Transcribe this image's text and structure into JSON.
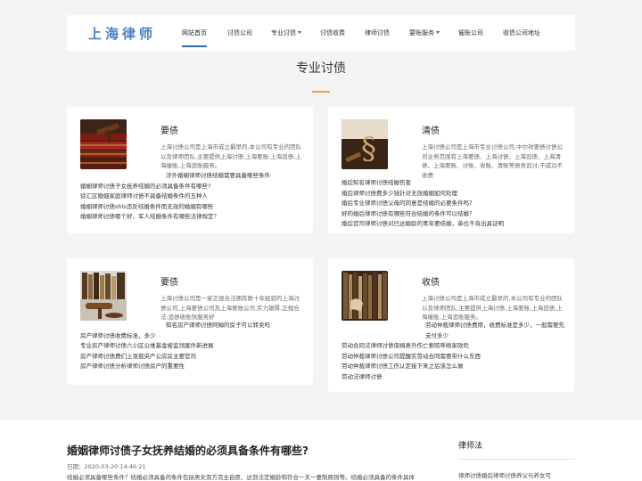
{
  "header": {
    "logo": "上海律师",
    "nav": [
      {
        "label": "网站首页",
        "active": true,
        "caret": false
      },
      {
        "label": "讨债公司",
        "active": false,
        "caret": false
      },
      {
        "label": "专业讨债",
        "active": false,
        "caret": true
      },
      {
        "label": "讨债收费",
        "active": false,
        "caret": false
      },
      {
        "label": "律师讨债",
        "active": false,
        "caret": false
      },
      {
        "label": "要账服务",
        "active": false,
        "caret": true
      },
      {
        "label": "催账公司",
        "active": false,
        "caret": false
      },
      {
        "label": "收债公司地址",
        "active": false,
        "caret": false
      }
    ]
  },
  "section": {
    "title": "专业讨债"
  },
  "cards": [
    {
      "name": "要债",
      "description": "上海讨债公司是上海市成立最早的,本公司有专业的团队以及律师团队,主要提供上海讨债,上海要账,上海追债,上海催账,上海追账服务。",
      "links": [
        "涉外婚姻律师讨债结婚需要具备哪些条件",
        "婚姻律师讨债子女抚养结婚的必须具备条件有哪些?",
        "徐汇区婚姻家庭律师讨债不具备结婚条件的五种人",
        "婚姻律师讨债shls违反结婚条件而无效的婚姻有哪些",
        "婚姻律师讨债哪个好，军人结婚条件有哪些法律规定？"
      ]
    },
    {
      "name": "清债",
      "description": "上海讨债公司是上海市专业讨债公司,中尔祥要债讨债公司业务范围有上海要债、上海讨债、上海追债、上海清债、上海要账、讨账、收账、清账等债务追讨,不成功不收费",
      "links": [
        "婚后知名律师讨债结婚伤害",
        "婚后律师讨债费多少钱针对无效婚姻如何处理",
        "婚后专业律师讨债父母的同意是结婚的必要条件吗？",
        "好的婚后律师讨债有哪些符合结婚的条件可以结婚？",
        "婚后官司律师讨债对已达婚龄的青年要结婚，单位不肯出具证明"
      ]
    },
    {
      "name": "要债",
      "description": "上海讨债公司是一家正规合法拥有数十年经验的上海讨债公司,上海要债公司及上海要账公司,实力雄厚,正规合法,追债收账快服务好",
      "links": [
        "知名房产律师讨债阿姆的房子可以转卖吗",
        "房产律师讨债收费标准，多少",
        "专业房产律师讨债六小区公维基金被监领案件新进展",
        "房产律师讨债费们上涨我央产公房房主要官司",
        "房产律师讨债分析律师讨债房产的重要性"
      ]
    },
    {
      "name": "收债",
      "description": "上海讨债公司是上海市成立最早的,本公司有专业的团队以及律师团队,主要提供上海讨债,上海要账,上海追债,上海催账,上海追账服务。",
      "links": [
        "劳动仲裁律师讨债费用，收费标准是多少，一般需要先支付多少",
        "劳动合同法律师讨债保姆意外伤亡索赔呼唤家政险",
        "劳动仲裁律师讨债公司提醒实劳动合同需要带什么东西",
        "劳动仲裁律师讨债工伤认定接下来之后该怎么做",
        "劳动法律师讨债"
      ]
    }
  ],
  "article": {
    "title": "婚姻律师讨债子女抚养结婚的必须具备条件有哪些?",
    "date": "日期：2020-03-20 14:46:21",
    "body": "结婚必须具备哪些条件？结婚必须具备的条件包括男女双方完全自愿、达到法定婚龄和符合一夫一妻制原则等。结婚必须具备的条件具体"
  },
  "sidebar": {
    "title": "律师法",
    "link": "律师讨债婚后律师讨债养父与养女可"
  }
}
